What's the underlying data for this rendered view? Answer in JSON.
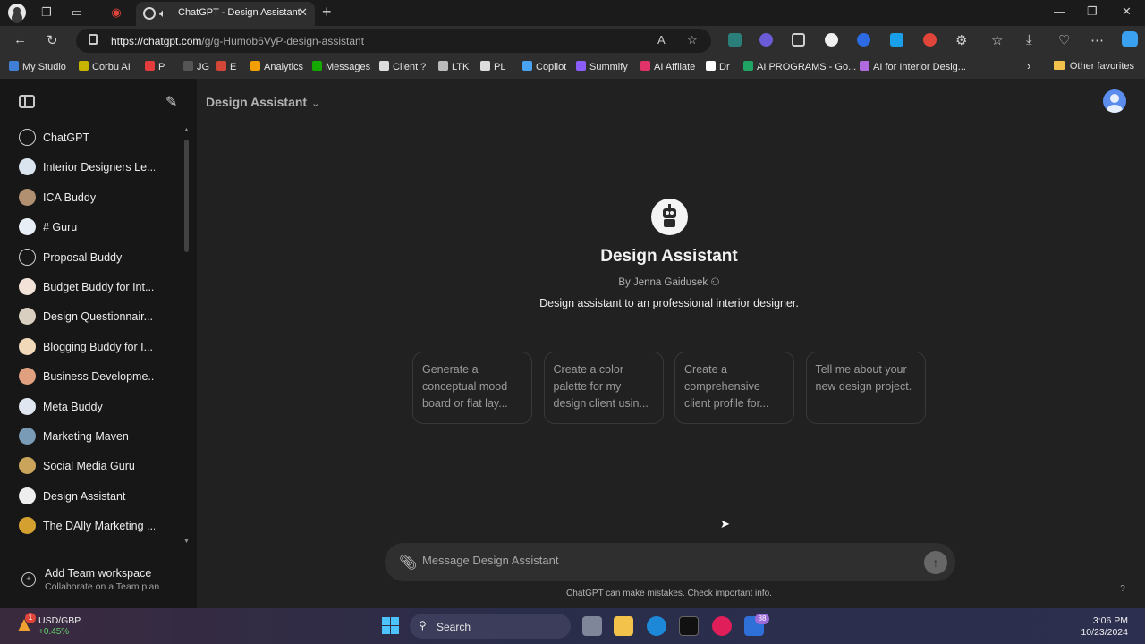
{
  "browser": {
    "tab_title": "ChatGPT - Design Assistant",
    "url_host": "https://chatgpt.com",
    "url_path": "/g/g-Humob6VyP-design-assistant"
  },
  "bookmarks": [
    {
      "label": "My Studio",
      "color": "#3f7fd6"
    },
    {
      "label": "Corbu AI",
      "color": "#c8b400"
    },
    {
      "label": "P",
      "color": "#e23c3c"
    },
    {
      "label": "JG",
      "color": "#555555"
    },
    {
      "label": "E",
      "color": "#d44638"
    },
    {
      "label": "Analytics",
      "color": "#f29f05"
    },
    {
      "label": "Messages",
      "color": "#14a800"
    },
    {
      "label": "Client ?",
      "color": "#dddddd"
    },
    {
      "label": "LTK",
      "color": "#bbbbbb"
    },
    {
      "label": "PL",
      "color": "#dddddd"
    },
    {
      "label": "Copilot",
      "color": "#4aa3f0"
    },
    {
      "label": "Summify",
      "color": "#8b5cf6"
    },
    {
      "label": "AI Affliate",
      "color": "#e0336a"
    },
    {
      "label": "Dr",
      "color": "#ffffff"
    },
    {
      "label": "AI PROGRAMS - Go...",
      "color": "#1fa463"
    },
    {
      "label": "AI for Interior Desig...",
      "color": "#b06adf"
    }
  ],
  "other_favorites": "Other favorites",
  "sidebar": {
    "gpts": [
      {
        "label": "ChatGPT",
        "color": "#171717"
      },
      {
        "label": "Interior Designers Le...",
        "color": "#d9e4ef"
      },
      {
        "label": "ICA Buddy",
        "color": "#b09070"
      },
      {
        "label": "# Guru",
        "color": "#e8eef5"
      },
      {
        "label": "Proposal Buddy",
        "color": "#171717"
      },
      {
        "label": "Budget Buddy for Int...",
        "color": "#f3e2d8"
      },
      {
        "label": "Design Questionnair...",
        "color": "#d8cfc0"
      },
      {
        "label": "Blogging Buddy for I...",
        "color": "#f0d8b8"
      },
      {
        "label": "Business Developme...",
        "color": "#e0a080"
      },
      {
        "label": "Meta Buddy",
        "color": "#dfe6f0"
      },
      {
        "label": "Marketing Maven",
        "color": "#7a9bb5"
      },
      {
        "label": "Social Media Guru",
        "color": "#c9a45a"
      },
      {
        "label": "Design Assistant",
        "color": "#eeeeee"
      },
      {
        "label": "The DAlly Marketing ...",
        "color": "#d4a030"
      }
    ],
    "team_title": "Add Team workspace",
    "team_sub": "Collaborate on a Team plan"
  },
  "main": {
    "model_name": "Design Assistant",
    "gpt_title": "Design Assistant",
    "author": "By Jenna Gaidusek",
    "description": "Design assistant to an professional interior designer.",
    "starters": [
      "Generate a conceptual mood board or flat lay...",
      "Create a color palette for my design client usin...",
      "Create a comprehensive client profile for...",
      "Tell me about your new design project."
    ],
    "composer_placeholder": "Message Design Assistant",
    "disclaimer": "ChatGPT can make mistakes. Check important info.",
    "help": "?"
  },
  "taskbar": {
    "ticker": "USD/GBP",
    "ticker_change": "+0.45%",
    "weather_badge": "1",
    "search_label": "Search",
    "app_badge": "88",
    "time": "3:06 PM",
    "date": "10/23/2024"
  }
}
